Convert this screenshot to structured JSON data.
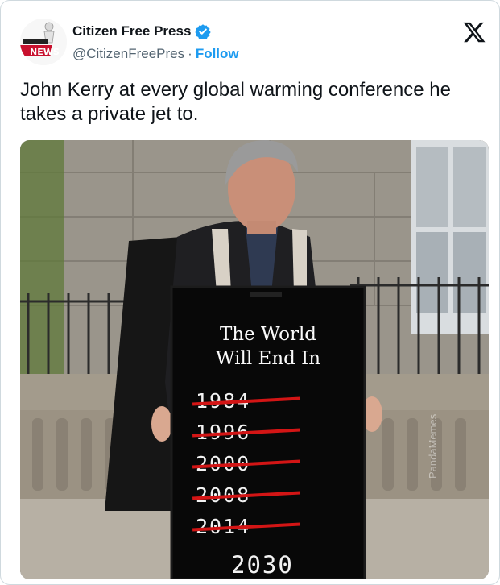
{
  "author": {
    "display_name": "Citizen Free Press",
    "handle": "@CitizenFreePres",
    "separator": "·",
    "follow_label": "Follow",
    "verified_icon": "verified-badge-icon",
    "avatar_text": "NEWS",
    "brand_color": "#1d9bf0"
  },
  "platform_icon": "x-logo-icon",
  "tweet": {
    "text": "John Kerry at every global warming conference he takes a private jet to."
  },
  "media": {
    "sign": {
      "heading_line1": "The World",
      "heading_line2": "Will End In",
      "crossed_years": [
        "1984",
        "1996",
        "2000",
        "2008",
        "2014"
      ],
      "current_year": "2030"
    },
    "watermark": "PandaMemes"
  }
}
